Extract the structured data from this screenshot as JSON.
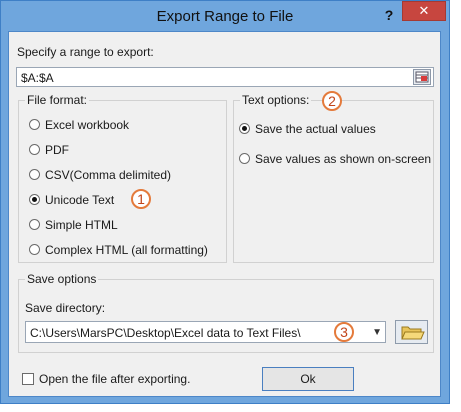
{
  "window": {
    "title": "Export Range to File",
    "help_glyph": "?",
    "close_glyph": "✕"
  },
  "range": {
    "label": "Specify a range to export:",
    "value": "$A:$A"
  },
  "file_format": {
    "title": "File format:",
    "options": [
      {
        "label": "Excel workbook",
        "selected": false
      },
      {
        "label": "PDF",
        "selected": false
      },
      {
        "label": "CSV(Comma delimited)",
        "selected": false
      },
      {
        "label": "Unicode Text",
        "selected": true
      },
      {
        "label": "Simple HTML",
        "selected": false
      },
      {
        "label": "Complex HTML (all formatting)",
        "selected": false
      }
    ]
  },
  "text_options": {
    "title": "Text options:",
    "options": [
      {
        "label": "Save the actual values",
        "selected": true
      },
      {
        "label": "Save values as shown on-screen",
        "selected": false
      }
    ]
  },
  "save_options": {
    "title": "Save options",
    "directory_label": "Save directory:",
    "directory_value": "C:\\Users\\MarsPC\\Desktop\\Excel data to Text Files\\"
  },
  "open_after": {
    "label": "Open the file after exporting.",
    "checked": false
  },
  "buttons": {
    "ok": "Ok"
  },
  "callouts": [
    "1",
    "2",
    "3"
  ],
  "icons": {
    "range_picker": "range-select-icon",
    "folder": "folder-icon",
    "dropdown": "chevron-down-icon"
  }
}
